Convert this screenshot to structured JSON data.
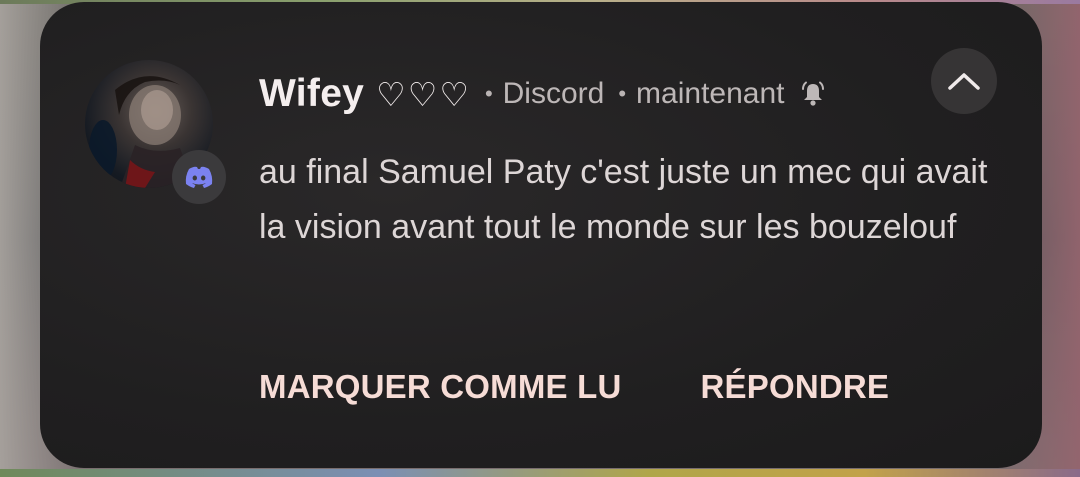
{
  "notification": {
    "sender": "Wifey",
    "sender_hearts": "♡♡♡",
    "separator": "•",
    "app_name": "Discord",
    "time": "maintenant",
    "message": "au final Samuel Paty c'est juste un mec qui avait la vision avant tout le monde sur les bouzelouf",
    "actions": {
      "mark_read": "MARQUER COMME LU",
      "reply": "RÉPONDRE"
    },
    "icons": {
      "app_badge": "discord-icon",
      "bell": "bell-alert-icon",
      "collapse": "chevron-up-icon"
    },
    "colors": {
      "card_background": "#201f20",
      "discord_accent": "#7b82f0",
      "action_text": "#f6dcd6",
      "primary_text": "#f4eeee",
      "secondary_text": "#bdb7b7"
    }
  }
}
